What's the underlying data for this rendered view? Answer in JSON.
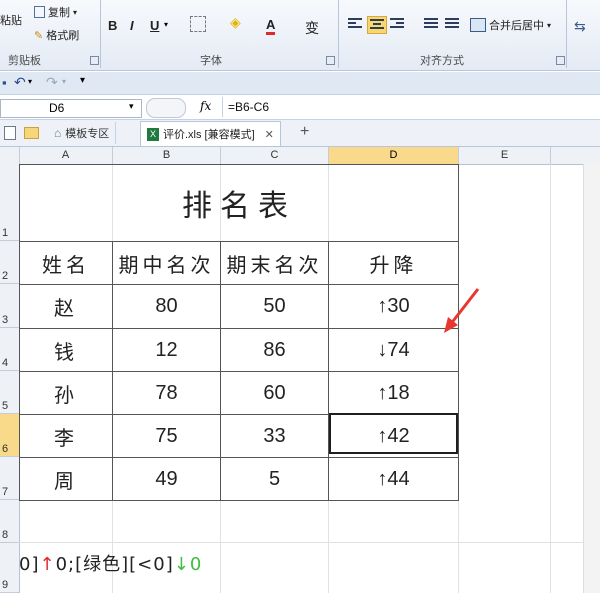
{
  "ribbon": {
    "clipboard": {
      "paste": "粘贴",
      "copy": "复制",
      "format_painter": "格式刷",
      "group": "剪贴板"
    },
    "font": {
      "bold": "B",
      "italic": "I",
      "underline": "U",
      "font_color": "A",
      "group": "字体",
      "change": "变"
    },
    "alignment": {
      "merge_center": "合并后居中",
      "group": "对齐方式"
    }
  },
  "formula_bar": {
    "name_box": "D6",
    "fx": "fx",
    "formula": "=B6-C6"
  },
  "tabs": [
    {
      "label": "模板专区"
    },
    {
      "label": "评价.xls [兼容模式]"
    }
  ],
  "columns": [
    "A",
    "B",
    "C",
    "D",
    "E"
  ],
  "rows": [
    "1",
    "2",
    "3",
    "4",
    "5",
    "6",
    "7",
    "8",
    "9"
  ],
  "sheet": {
    "title": "排名表",
    "headers": [
      "姓名",
      "期中名次",
      "期末名次",
      "升降"
    ],
    "records": [
      {
        "name": "赵",
        "mid": "80",
        "final": "50",
        "arrow": "↑",
        "change": "30",
        "dir": "up"
      },
      {
        "name": "钱",
        "mid": "12",
        "final": "86",
        "arrow": "↓",
        "change": "74",
        "dir": "down"
      },
      {
        "name": "孙",
        "mid": "78",
        "final": "60",
        "arrow": "↑",
        "change": "18",
        "dir": "up"
      },
      {
        "name": "李",
        "mid": "75",
        "final": "33",
        "arrow": "↑",
        "change": "42",
        "dir": "up"
      },
      {
        "name": "周",
        "mid": "49",
        "final": "5",
        "arrow": "↑",
        "change": "44",
        "dir": "up"
      }
    ],
    "format_pieces": [
      {
        "text": "0]",
        "color": "#222222"
      },
      {
        "text": "↑",
        "color": "#e02a2a"
      },
      {
        "text": "0;[绿色][<0]",
        "color": "#222222"
      },
      {
        "text": "↓",
        "color": "#3ebd3e"
      },
      {
        "text": "0",
        "color": "#3ebd3e"
      }
    ]
  },
  "colors": {
    "up": "#e02a2a",
    "down": "#3ebd3e",
    "selected_header": "#f9d98a",
    "annotation_arrow": "#e8372e"
  }
}
